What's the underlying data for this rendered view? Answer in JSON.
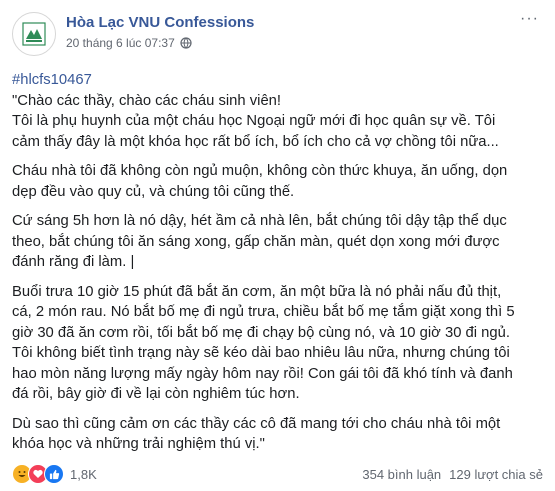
{
  "page": {
    "name": "Hòa Lạc VNU Confessions",
    "timestamp": "20 tháng 6 lúc 07:37",
    "more_icon": "more-icon",
    "privacy_icon": "globe-icon"
  },
  "post": {
    "hashtag": "#hlcfs10467",
    "paragraphs": [
      [
        "\"Chào các thầy, chào các cháu sinh viên!",
        "Tôi là phụ huynh của một cháu học Ngoại ngữ mới đi học quân sự về. Tôi",
        "cảm thấy đây là một khóa học rất bổ ích, bổ ích cho cả vợ chồng tôi nữa..."
      ],
      [
        "Cháu nhà tôi đã không còn ngủ muộn, không còn thức khuya, ăn uống, dọn",
        "dẹp đều vào quy củ, và chúng tôi cũng thế."
      ],
      [
        "Cứ sáng 5h hơn là nó dậy, hét ầm cả nhà lên, bắt chúng tôi dậy tập thể dục",
        "theo, bắt chúng tôi ăn sáng xong, gấp chăn màn, quét dọn xong mới được",
        "đánh răng đi làm. |"
      ],
      [
        "Buổi trưa 10 giờ 15 phút đã bắt ăn cơm, ăn một bữa là nó phải nấu đủ thịt,",
        "cá, 2 món rau. Nó bắt bố mẹ đi ngủ trưa, chiều bắt bố mẹ tắm giặt xong thì 5",
        "giờ 30 đã ăn cơm rồi, tối bắt bố mẹ đi chạy bộ cùng nó, và 10 giờ 30 đi ngủ.",
        "Tôi không biết tình trạng này sẽ kéo dài bao nhiêu lâu nữa, nhưng chúng tôi",
        "hao mòn năng lượng mấy ngày hôm nay rồi! Con gái tôi đã khó tính và đanh",
        "đá rồi, bây giờ đi về lại còn nghiêm túc hơn."
      ],
      [
        "Dù sao thì cũng cảm ơn các thầy các cô đã mang tới cho cháu nhà tôi một",
        "khóa học và những trải nghiệm thú vị.\""
      ]
    ]
  },
  "footer": {
    "reaction_icons": [
      "haha-icon",
      "love-icon",
      "like-icon"
    ],
    "reaction_count": "1,8K",
    "comments": "354 bình luận",
    "shares": "129 lượt chia sẻ"
  },
  "colors": {
    "name_link": "#385898",
    "meta_text": "#616770",
    "body_text": "#1c1e21",
    "like_blue": "#1877f2",
    "love_red": "#f33e58",
    "haha_yellow": "#f7b125"
  }
}
